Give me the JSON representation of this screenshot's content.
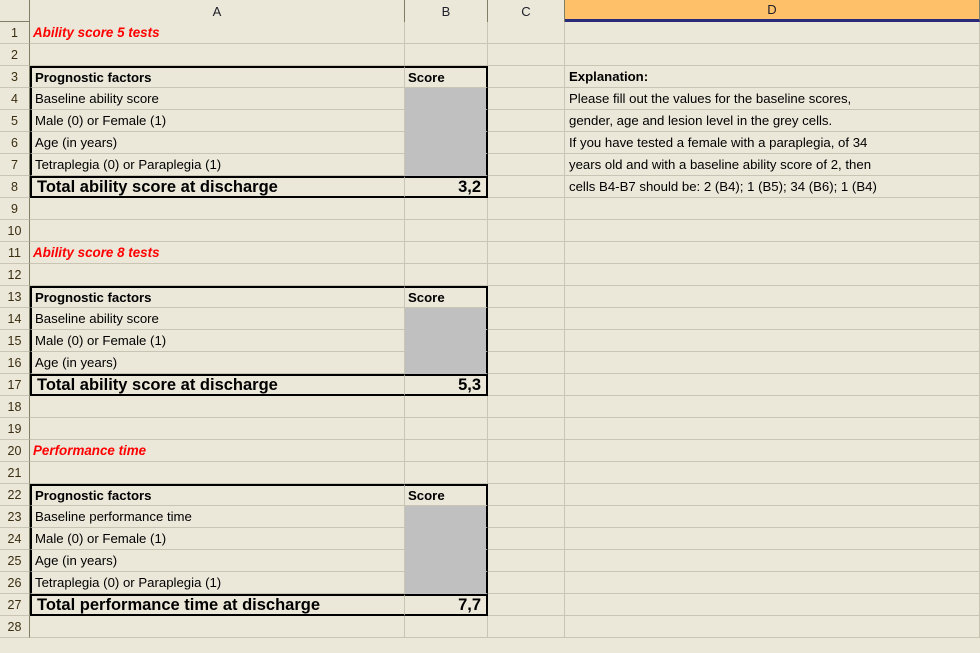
{
  "spreadsheet": {
    "columns": [
      "A",
      "B",
      "C",
      "D"
    ],
    "selected_column": "D",
    "row_numbers": [
      1,
      2,
      3,
      4,
      5,
      6,
      7,
      8,
      9,
      10,
      11,
      12,
      13,
      14,
      15,
      16,
      17,
      18,
      19,
      20,
      21,
      22,
      23,
      24,
      25,
      26,
      27,
      28
    ],
    "colors": {
      "sheet_background": "#ebe8da",
      "input_cell_grey": "#c0c0c0",
      "selected_header_orange": "#ffc06a",
      "selected_header_underline": "#2a2a7a",
      "heading_red": "#ff0000",
      "gridline": "#c8c5b4",
      "header_border": "#7f7f66"
    }
  },
  "blocks": [
    {
      "title": "Ability score 5 tests",
      "title_row": 1,
      "header": {
        "factors": "Prognostic factors",
        "score": "Score"
      },
      "header_row": 3,
      "factors": [
        "Baseline ability score",
        "Male (0) or Female (1)",
        "Age (in years)",
        "Tetraplegia (0) or Paraplegia (1)"
      ],
      "factor_rows": [
        4,
        5,
        6,
        7
      ],
      "total_label": "Total ability score at discharge",
      "total_value": "3,2",
      "total_row": 8
    },
    {
      "title": "Ability score 8 tests",
      "title_row": 11,
      "header": {
        "factors": "Prognostic factors",
        "score": "Score"
      },
      "header_row": 13,
      "factors": [
        "Baseline ability score",
        "Male (0) or Female (1)",
        "Age (in years)"
      ],
      "factor_rows": [
        14,
        15,
        16
      ],
      "total_label": "Total ability score at discharge",
      "total_value": "5,3",
      "total_row": 17
    },
    {
      "title": "Performance time",
      "title_row": 20,
      "header": {
        "factors": "Prognostic factors",
        "score": "Score"
      },
      "header_row": 22,
      "factors": [
        "Baseline performance time",
        "Male (0) or Female (1)",
        "Age (in years)",
        "Tetraplegia (0) or Paraplegia (1)"
      ],
      "factor_rows": [
        23,
        24,
        25,
        26
      ],
      "total_label": "Total performance time at discharge",
      "total_value": "7,7",
      "total_row": 27
    }
  ],
  "explanation": {
    "heading": "Explanation:",
    "heading_row": 3,
    "lines": [
      "Please fill out the values for the baseline scores,",
      "gender, age and lesion level in the grey cells.",
      "If you have tested a female with a paraplegia, of 34",
      "years old and with a baseline ability score of 2, then",
      "cells B4-B7 should be: 2 (B4); 1 (B5); 34 (B6); 1 (B4)"
    ],
    "line_rows": [
      4,
      5,
      6,
      7
    ]
  }
}
